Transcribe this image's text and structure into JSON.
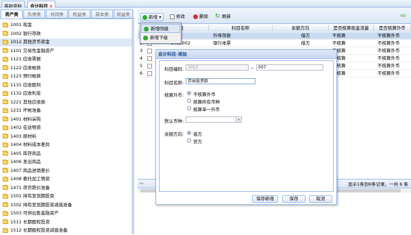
{
  "top_tabs": [
    {
      "label": "基础资料"
    },
    {
      "label": "会计科目"
    }
  ],
  "close_glyph": "×",
  "category_tabs": [
    {
      "label": "资产类"
    },
    {
      "label": "负债类"
    },
    {
      "label": "共同类"
    },
    {
      "label": "权益类"
    },
    {
      "label": "成本类"
    },
    {
      "label": "损益类"
    }
  ],
  "tree_items": [
    {
      "label": "1001  现金"
    },
    {
      "label": "1002  银行存款"
    },
    {
      "label": "1012  其他货币资金"
    },
    {
      "label": "1101  交易性金融资产"
    },
    {
      "label": "1121  应收票据"
    },
    {
      "label": "1122  应收帐款"
    },
    {
      "label": "1123  预付帐款"
    },
    {
      "label": "1131  应收股利"
    },
    {
      "label": "1132  应收利息"
    },
    {
      "label": "1221  其他应收款"
    },
    {
      "label": "1231  坏帐准备"
    },
    {
      "label": "1401  材料采购"
    },
    {
      "label": "1402  在途物资"
    },
    {
      "label": "1403  原材料"
    },
    {
      "label": "1404  材料成本差异"
    },
    {
      "label": "1405  库存商品"
    },
    {
      "label": "1406  发出商品"
    },
    {
      "label": "1407  商品进销差价"
    },
    {
      "label": "1408  委托加工物资"
    },
    {
      "label": "1471  存货跌价准备"
    },
    {
      "label": "1501  持有至到期投资"
    },
    {
      "label": "1502  持有至到期投资减值准备"
    },
    {
      "label": "1503  可供出售金融资产"
    },
    {
      "label": "1511  长期股权投资"
    },
    {
      "label": "1512  长期股权投资减值准备"
    }
  ],
  "toolbar": {
    "new_label": "新增",
    "new_arrow": "▾",
    "edit_label": "修改",
    "delete_label": "删除",
    "refresh_label": "刷新",
    "refresh_glyph": "↻",
    "exit_glyph": "⇨"
  },
  "new_menu": {
    "same_level": "新增同级",
    "sub_level": "新增下级"
  },
  "grid": {
    "headers": {
      "code": "码",
      "name": "科目名称",
      "direction": "余额方向",
      "cashflow": "是否核算现金流量",
      "foreign": "是否核算外币"
    },
    "rows": [
      {
        "code": "01",
        "name": "外埠存款",
        "direction": "借方",
        "cashflow": "不核算",
        "foreign": "不核算外币",
        "selected": true
      },
      {
        "code": "1012002",
        "name": "银行本票",
        "direction": "借方",
        "cashflow": "不核算",
        "foreign": "不核算外币",
        "selected": false
      },
      {
        "code": "",
        "name": "",
        "direction": "",
        "cashflow": "不核算",
        "foreign": "不核算外币",
        "selected": false
      },
      {
        "code": "",
        "name": "",
        "direction": "",
        "cashflow": "不核算",
        "foreign": "不核算外币",
        "selected": false
      },
      {
        "code": "",
        "name": "",
        "direction": "",
        "cashflow": "不核算",
        "foreign": "不核算外币",
        "selected": false
      },
      {
        "code": "",
        "name": "",
        "direction": "",
        "cashflow": "不核算",
        "foreign": "不核算外币",
        "selected": false
      }
    ],
    "row_numbers": [
      "1",
      "2",
      "3",
      "4",
      "5",
      "6"
    ]
  },
  "pager": {
    "first_glyph": "⏮",
    "info": "显示1条到6条记录，一共 6 条"
  },
  "modal": {
    "title": "会计科目-添加",
    "code_label": "科目编码:",
    "code_prefix": "1012",
    "code_separator": "--",
    "code_suffix": "007",
    "name_label": "科目名称:",
    "name_value": "存出投资款",
    "foreign_label": "核算外币:",
    "foreign_options": [
      "不核算外币",
      "核算所有币种",
      "核算单一外币"
    ],
    "foreign_selected": 0,
    "currency_label": "默认币种:",
    "currency_value": "",
    "combo_arrow_glyph": "▾",
    "direction_label": "余额方向:",
    "direction_options": [
      "借方",
      "贷方"
    ],
    "direction_selected": 0,
    "save_new_label": "保存新增",
    "save_label": "保存",
    "cancel_label": "取消"
  }
}
